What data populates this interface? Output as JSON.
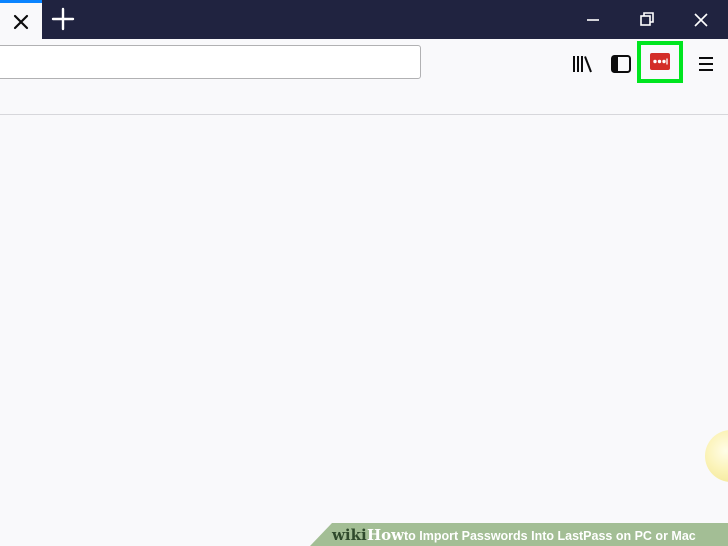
{
  "titlebar": {
    "tab": {
      "close_icon": "close-icon"
    },
    "new_tab_icon": "plus-icon",
    "window_controls": [
      "minimize-icon",
      "restore-icon",
      "close-icon"
    ]
  },
  "toolbar": {
    "urlbar": {
      "value": "",
      "placeholder": ""
    },
    "icons": [
      "library-icon",
      "sidebar-icon",
      "lastpass-icon",
      "hamburger-menu-icon"
    ],
    "highlight_color": "#00e51f",
    "lastpass_color": "#d32d27"
  },
  "watermark": {
    "wiki": "wiki",
    "how": "How",
    "title": "to Import Passwords Into LastPass on PC or Mac"
  },
  "colors": {
    "titlebar": "#202340",
    "tab_accent": "#0a84ff",
    "page_background": "#f9f9fb"
  }
}
